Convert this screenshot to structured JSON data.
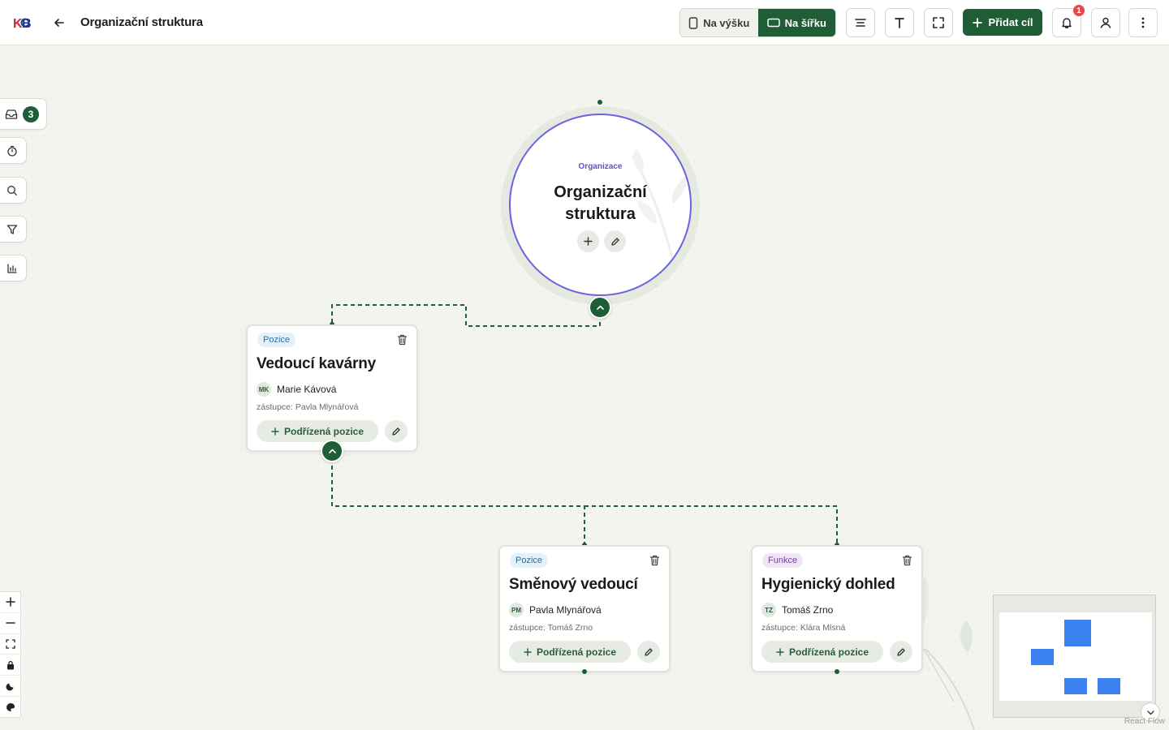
{
  "header": {
    "title": "Organizační struktura",
    "orientation": {
      "portrait_label": "Na výšku",
      "landscape_label": "Na šířku",
      "active": "landscape"
    },
    "add_goal_label": "Přidat cíl",
    "notification_count": "1"
  },
  "sidebar": {
    "inbox_count": "3"
  },
  "org": {
    "label": "Organizace",
    "title_line1": "Organizační",
    "title_line2": "struktura"
  },
  "cards": [
    {
      "tag": "Pozice",
      "title": "Vedoucí kavárny",
      "initials": "MK",
      "person": "Marie Kávová",
      "deputy": "zástupce: Pavla Mlynářová",
      "sub_label": "Podřízená pozice"
    },
    {
      "tag": "Pozice",
      "title": "Směnový vedoucí",
      "initials": "PM",
      "person": "Pavla Mlynářová",
      "deputy": "zástupce: Tomáš Zrno",
      "sub_label": "Podřízená pozice"
    },
    {
      "tag": "Funkce",
      "title": "Hygienický dohled",
      "initials": "TZ",
      "person": "Tomáš Zrno",
      "deputy": "zástupce: Klára Mlsná",
      "sub_label": "Podřízená pozice"
    }
  ],
  "attribution": "React Flow",
  "colors": {
    "primary": "#1f5d36",
    "accent_ring": "#6b63e0",
    "badge": "#e5484d",
    "minimap_node": "#3b82f0"
  }
}
